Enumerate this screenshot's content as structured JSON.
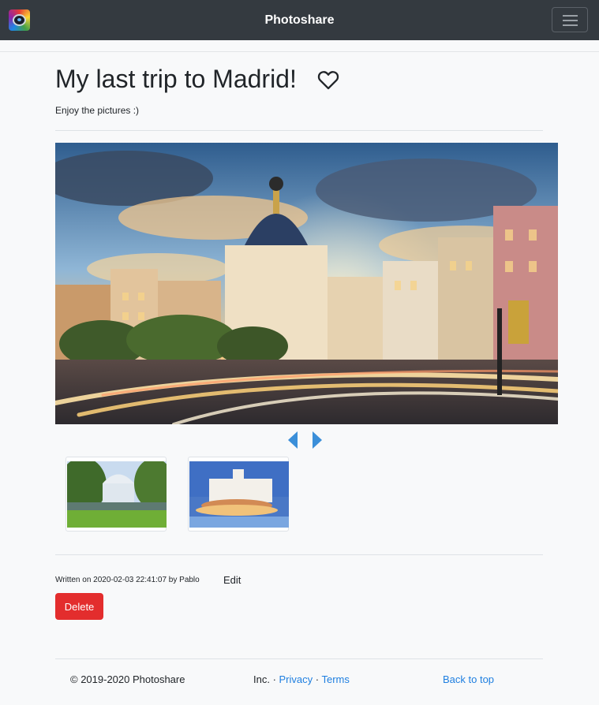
{
  "navbar": {
    "brand": "Photoshare",
    "logo_icon": "camera-lens-icon",
    "menu_icon": "hamburger-menu-icon"
  },
  "post": {
    "title": "My last trip to Madrid!",
    "like_icon": "heart-outline-icon",
    "description": "Enjoy the pictures :)",
    "meta": "Written on 2020-02-03 22:41:07 by Pablo",
    "edit_label": "Edit",
    "delete_label": "Delete"
  },
  "carousel": {
    "prev_icon": "caret-left-icon",
    "next_icon": "caret-right-icon",
    "arrow_color": "#3b8fd9"
  },
  "footer": {
    "copyright": "© 2019-2020 Photoshare",
    "inc_prefix": "Inc. · ",
    "privacy": "Privacy",
    "separator": " · ",
    "terms": "Terms",
    "back_to_top": "Back to top"
  },
  "colors": {
    "navbar_bg": "#343a40",
    "link": "#1f7fe0",
    "danger": "#e32d2d"
  }
}
